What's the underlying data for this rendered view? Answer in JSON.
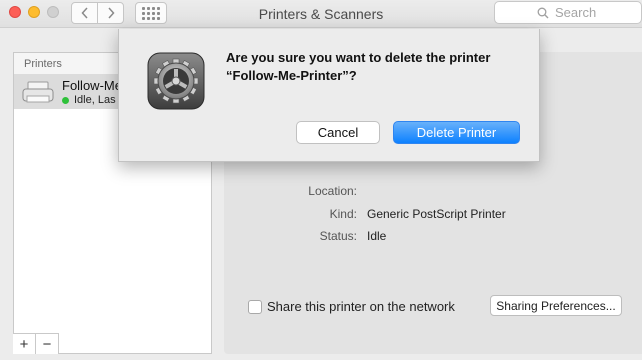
{
  "window": {
    "title": "Printers & Scanners"
  },
  "search": {
    "placeholder": "Search"
  },
  "printers_panel": {
    "header": "Printers",
    "items": [
      {
        "name": "Follow-Me",
        "status": "Idle, Las"
      }
    ]
  },
  "details": {
    "location_label": "Location:",
    "location_value": "",
    "kind_label": "Kind:",
    "kind_value": "Generic PostScript Printer",
    "status_label": "Status:",
    "status_value": "Idle",
    "share_label": "Share this printer on the network",
    "sharing_button": "Sharing Preferences..."
  },
  "dialog": {
    "message_line1": "Are you sure you want to delete the printer",
    "message_line2": "“Follow-Me-Printer”?",
    "cancel_label": "Cancel",
    "confirm_label": "Delete Printer"
  },
  "controls": {
    "add_label": "+",
    "remove_label": "−"
  },
  "colors": {
    "accent": "#0d81ff",
    "status_idle": "#2ec13a",
    "close": "#fc5f57",
    "minimize": "#fdbc2e"
  },
  "icons": [
    "back-icon",
    "forward-icon",
    "grid-icon",
    "search-icon",
    "printer-icon",
    "system-preferences-gear-icon"
  ]
}
